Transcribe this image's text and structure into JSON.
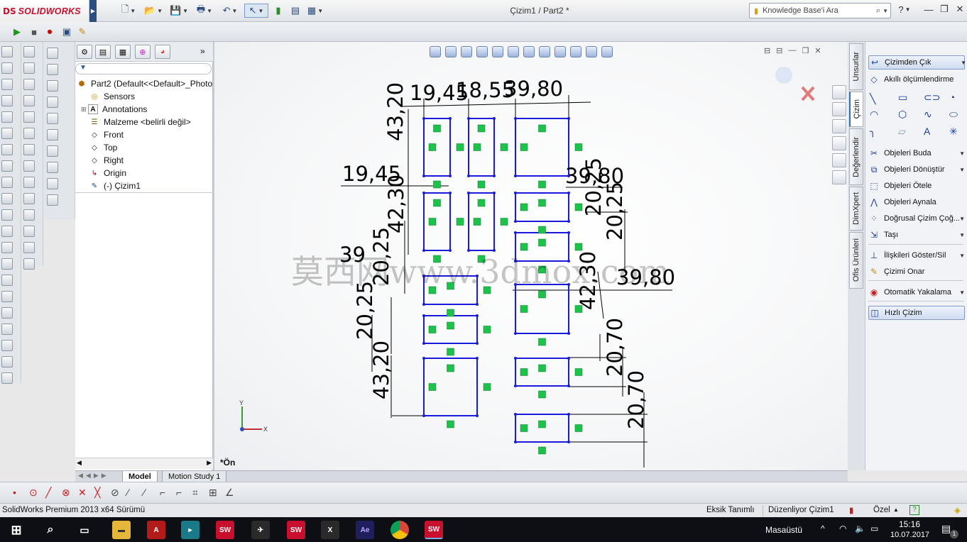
{
  "app": {
    "brand_mark": "DS",
    "brand_name": "SOLIDWORKS",
    "doc_title": "Çizim1 / Part2 *"
  },
  "search": {
    "placeholder": "Knowledge Base'i Ara"
  },
  "feature_manager": {
    "root": "Part2  (Default<<Default>_Photo",
    "items": [
      {
        "label": "Sensors"
      },
      {
        "label": "Annotations"
      },
      {
        "label": "Malzeme <belirli değil>"
      },
      {
        "label": "Front"
      },
      {
        "label": "Top"
      },
      {
        "label": "Right"
      },
      {
        "label": "Origin"
      },
      {
        "label": "(-) Çizim1"
      }
    ]
  },
  "viewport": {
    "view_label": "*Ön",
    "watermark": "莫西网www.3dmox.com",
    "triad_x": "X",
    "triad_y": "Y"
  },
  "dimensions": [
    {
      "id": "d1",
      "text": "19,45"
    },
    {
      "id": "d2",
      "text": "18,55"
    },
    {
      "id": "d3",
      "text": "39,80"
    },
    {
      "id": "d4",
      "text": "43,20"
    },
    {
      "id": "d5",
      "text": "19,45"
    },
    {
      "id": "d6",
      "text": "39,80"
    },
    {
      "id": "d7",
      "text": "42,30"
    },
    {
      "id": "d8",
      "text": "20,25"
    },
    {
      "id": "d9",
      "text": "20,25"
    },
    {
      "id": "d10",
      "text": "39"
    },
    {
      "id": "d11",
      "text": "20,25"
    },
    {
      "id": "d12",
      "text": "39,80"
    },
    {
      "id": "d13",
      "text": "20,25"
    },
    {
      "id": "d14",
      "text": "42,30"
    },
    {
      "id": "d15",
      "text": "20,70"
    },
    {
      "id": "d16",
      "text": "43,20"
    },
    {
      "id": "d17",
      "text": "20,70"
    }
  ],
  "taskpane_tabs": [
    {
      "label": "Unsurlar"
    },
    {
      "label": "Çizim"
    },
    {
      "label": "Değerlendir"
    },
    {
      "label": "DimXpert"
    },
    {
      "label": "Ofis Ürünleri"
    }
  ],
  "command_manager": [
    {
      "label": "Çizimden Çık",
      "icon": "exit-sketch-icon"
    },
    {
      "label": "Akıllı ölçümlendirme",
      "icon": "smart-dimension-icon"
    },
    {
      "label": "Objeleri Buda",
      "icon": "trim-icon"
    },
    {
      "label": "Objeleri Dönüştür",
      "icon": "convert-icon"
    },
    {
      "label": "Objeleri Ötele",
      "icon": "offset-icon"
    },
    {
      "label": "Objeleri Aynala",
      "icon": "mirror-icon"
    },
    {
      "label": "Doğrusal Çizim Çoğ...",
      "icon": "linear-pattern-icon"
    },
    {
      "label": "Taşı",
      "icon": "move-icon"
    },
    {
      "label": "İlişkileri Göster/Sil",
      "icon": "relations-icon"
    },
    {
      "label": "Çizimi Onar",
      "icon": "repair-icon"
    },
    {
      "label": "Otomatik Yakalama",
      "icon": "snap-icon"
    },
    {
      "label": "Hızlı Çizim",
      "icon": "rapid-sketch-icon"
    }
  ],
  "bottom_tabs": [
    {
      "label": "Model"
    },
    {
      "label": "Motion Study 1"
    }
  ],
  "status": {
    "product": "SolidWorks Premium 2013 x64 Sürümü",
    "definition": "Eksik Tanımlı",
    "mode": "Düzenliyor Çizim1",
    "units": "Özel"
  },
  "taskbar": {
    "desktop_label": "Masaüstü",
    "time": "15:16",
    "date": "10.07.2017",
    "notification_count": "1"
  },
  "colors": {
    "sketch_blue": "#1a1adb",
    "relation_green": "#1cc24a",
    "brand_red": "#c8102e"
  }
}
